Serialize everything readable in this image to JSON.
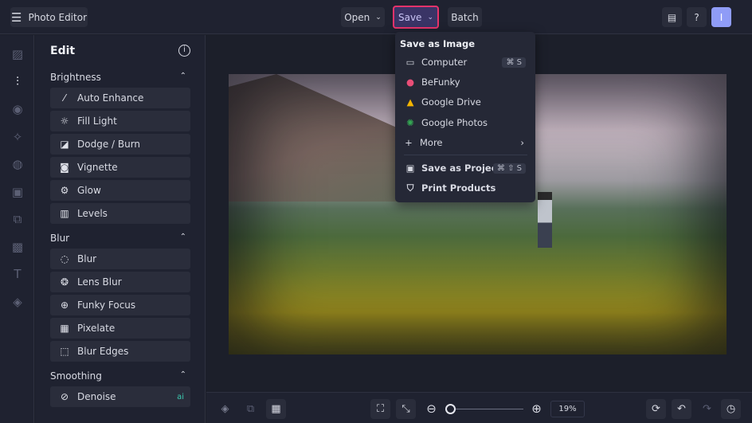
{
  "header": {
    "app_title": "Photo Editor",
    "open_label": "Open",
    "save_label": "Save",
    "batch_label": "Batch",
    "avatar_initial": "I"
  },
  "panel": {
    "title": "Edit",
    "sections": [
      {
        "label": "Brightness",
        "items": [
          "Auto Enhance",
          "Fill Light",
          "Dodge / Burn",
          "Vignette",
          "Glow",
          "Levels"
        ]
      },
      {
        "label": "Blur",
        "items": [
          "Blur",
          "Lens Blur",
          "Funky Focus",
          "Pixelate",
          "Blur Edges"
        ]
      },
      {
        "label": "Smoothing",
        "items": [
          "Denoise"
        ]
      }
    ]
  },
  "save_menu": {
    "heading": "Save as Image",
    "items": [
      {
        "label": "Computer",
        "shortcut": "⌘ S"
      },
      {
        "label": "BeFunky"
      },
      {
        "label": "Google Drive"
      },
      {
        "label": "Google Photos"
      },
      {
        "label": "More"
      }
    ],
    "project": {
      "label": "Save as Project",
      "shortcut": "⌘ ⇧ S"
    },
    "print": {
      "label": "Print Products"
    }
  },
  "bottom": {
    "zoom_level": "19%",
    "zoom_fraction": 0.04
  },
  "colors": {
    "accent": "#e8336b",
    "save_bg": "#3a3466"
  }
}
